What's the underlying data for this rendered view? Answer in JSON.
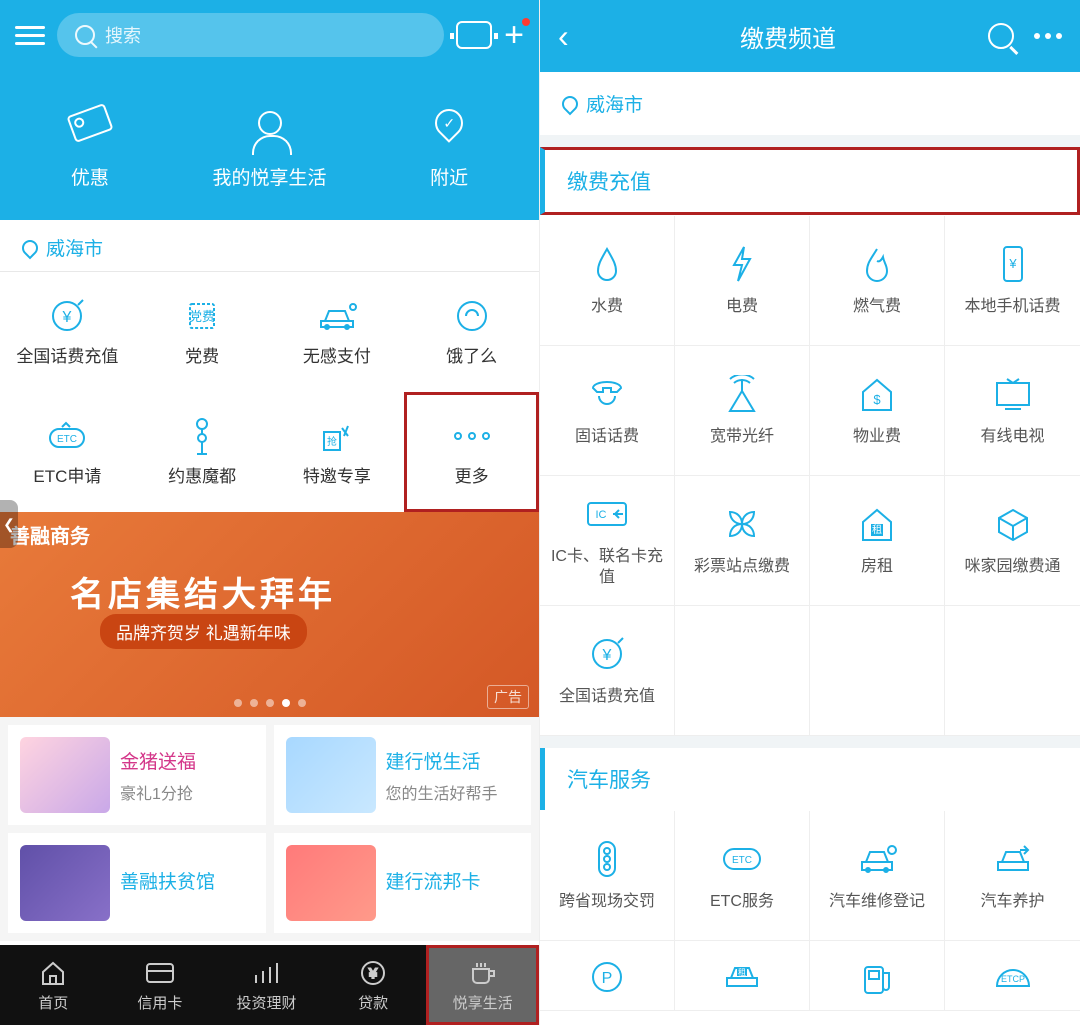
{
  "left": {
    "search_placeholder": "搜索",
    "top_tabs": [
      "优惠",
      "我的悦享生活",
      "附近"
    ],
    "location": "威海市",
    "grid": [
      "全国话费充值",
      "党费",
      "无感支付",
      "饿了么",
      "ETC申请",
      "约惠魔都",
      "特邀专享",
      "更多"
    ],
    "banner": {
      "tag": "善融商务",
      "title": "名店集结大拜年",
      "sub": "品牌齐贺岁 礼遇新年味",
      "ad": "广告"
    },
    "promos": [
      {
        "title": "金猪送福",
        "sub": "豪礼1分抢"
      },
      {
        "title": "建行悦生活",
        "sub": "您的生活好帮手"
      },
      {
        "title": "善融扶贫馆",
        "sub": ""
      },
      {
        "title": "建行流邦卡",
        "sub": ""
      }
    ],
    "nav": [
      "首页",
      "信用卡",
      "投资理财",
      "贷款",
      "悦享生活"
    ]
  },
  "right": {
    "title": "缴费频道",
    "location": "威海市",
    "section1": "缴费充值",
    "grid1": [
      "水费",
      "电费",
      "燃气费",
      "本地手机话费",
      "固话话费",
      "宽带光纤",
      "物业费",
      "有线电视",
      "IC卡、联名卡充值",
      "彩票站点缴费",
      "房租",
      "咪家园缴费通",
      "全国话费充值"
    ],
    "section2": "汽车服务",
    "grid2": [
      "跨省现场交罚",
      "ETC服务",
      "汽车维修登记",
      "汽车养护"
    ]
  }
}
